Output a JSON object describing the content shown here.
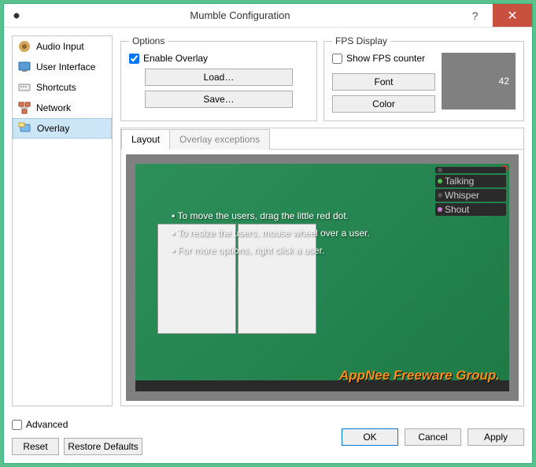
{
  "titlebar": {
    "title": "Mumble Configuration"
  },
  "sidebar": {
    "items": [
      {
        "label": "Audio Input"
      },
      {
        "label": "User Interface"
      },
      {
        "label": "Shortcuts"
      },
      {
        "label": "Network"
      },
      {
        "label": "Overlay"
      }
    ]
  },
  "options": {
    "legend": "Options",
    "enable_overlay": "Enable Overlay",
    "load": "Load…",
    "save": "Save…"
  },
  "fps": {
    "legend": "FPS Display",
    "show_counter": "Show FPS counter",
    "font": "Font",
    "color": "Color",
    "preview_value": "42"
  },
  "tabs": {
    "layout": "Layout",
    "exceptions": "Overlay exceptions"
  },
  "instructions": {
    "line1": "To move the users, drag the little red dot.",
    "line2": "To resize the users, mouse wheel over a user.",
    "line3": "For more options, right click a user."
  },
  "userpanel": {
    "u1": "",
    "u2": "Talking",
    "u3": "Whisper",
    "u4": "Shout"
  },
  "watermark": "AppNee Freeware Group.",
  "footer": {
    "advanced": "Advanced",
    "reset": "Reset",
    "restore": "Restore Defaults",
    "ok": "OK",
    "cancel": "Cancel",
    "apply": "Apply"
  }
}
